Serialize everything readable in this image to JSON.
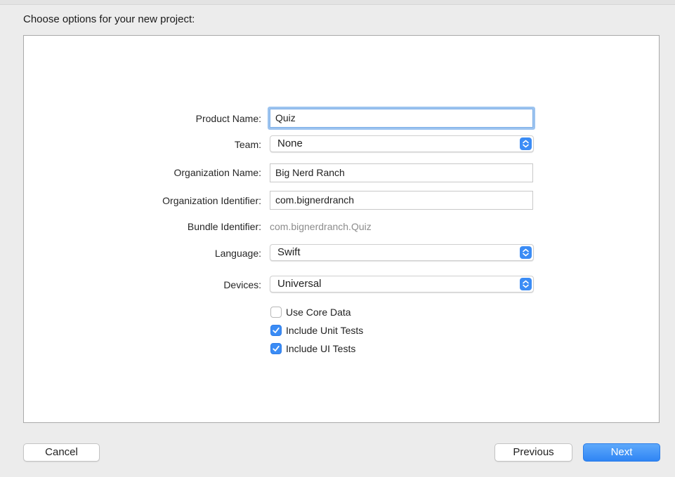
{
  "header": {
    "title": "Choose options for your new project:"
  },
  "form": {
    "product_name": {
      "label": "Product Name:",
      "value": "Quiz"
    },
    "team": {
      "label": "Team:",
      "value": "None"
    },
    "organization_name": {
      "label": "Organization Name:",
      "value": "Big Nerd Ranch"
    },
    "organization_identifier": {
      "label": "Organization Identifier:",
      "value": "com.bignerdranch"
    },
    "bundle_identifier": {
      "label": "Bundle Identifier:",
      "value": "com.bignerdranch.Quiz"
    },
    "language": {
      "label": "Language:",
      "value": "Swift"
    },
    "devices": {
      "label": "Devices:",
      "value": "Universal"
    }
  },
  "options": [
    {
      "label": "Use Core Data",
      "checked": false
    },
    {
      "label": "Include Unit Tests",
      "checked": true
    },
    {
      "label": "Include UI Tests",
      "checked": true
    }
  ],
  "buttons": {
    "cancel": "Cancel",
    "previous": "Previous",
    "next": "Next"
  },
  "icons": {
    "popup_stepper": "chevron-up-down-icon",
    "checkmark": "checkmark-icon"
  },
  "colors": {
    "accent": "#3b8cf5",
    "focus_ring": "#9cc3ef",
    "window_bg": "#ececec"
  }
}
